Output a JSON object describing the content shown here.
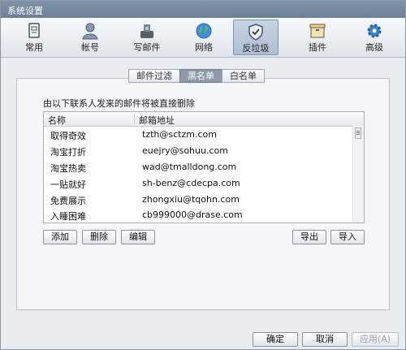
{
  "window": {
    "title": "系统设置"
  },
  "toolbar": {
    "items": [
      {
        "label": "常用",
        "icon": "document-icon"
      },
      {
        "label": "帐号",
        "icon": "user-icon"
      },
      {
        "label": "写邮件",
        "icon": "compose-icon"
      },
      {
        "label": "网络",
        "icon": "globe-icon"
      },
      {
        "label": "反垃圾",
        "icon": "shield-icon",
        "active": true
      },
      {
        "label": "插件",
        "icon": "box-icon"
      },
      {
        "label": "高级",
        "icon": "gear-icon"
      }
    ]
  },
  "tabs": [
    {
      "label": "邮件过滤"
    },
    {
      "label": "黑名单",
      "active": true
    },
    {
      "label": "白名单"
    }
  ],
  "blacklist": {
    "description": "由以下联系人发来的邮件将被直接删除",
    "columns": {
      "name": "名称",
      "email": "邮箱地址"
    },
    "rows": [
      {
        "name": "取得奇效",
        "email": "tzth@sctzm.com"
      },
      {
        "name": "淘宝打折",
        "email": "euejry@sohuu.com"
      },
      {
        "name": "淘宝热卖",
        "email": "wad@tmalldong.com"
      },
      {
        "name": "一贴就好",
        "email": "sh-benz@cdecpa.com"
      },
      {
        "name": "免费展示",
        "email": "zhongxiu@tqohn.com"
      },
      {
        "name": "入睡困难",
        "email": "cb999000@drase.com"
      }
    ],
    "buttons": {
      "add": "添加",
      "delete": "删除",
      "edit": "编辑",
      "export": "导出",
      "import": "导入"
    }
  },
  "footer": {
    "ok": "确定",
    "cancel": "取消",
    "apply": "应用(A)"
  },
  "colors": {
    "titlebar": "#7588a0",
    "active_tab": "#8e9aa8",
    "active_tool": "#aebfd4",
    "accent_globe": "#3f8fd6"
  }
}
